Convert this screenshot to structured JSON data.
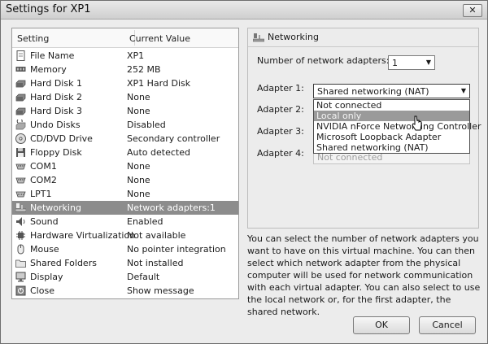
{
  "window": {
    "title": "Settings for XP1",
    "close_glyph": "✕"
  },
  "list": {
    "headers": [
      "Setting",
      "Current Value"
    ],
    "rows": [
      {
        "name": "File Name",
        "value": "XP1",
        "icon": "file-icon"
      },
      {
        "name": "Memory",
        "value": "252 MB",
        "icon": "memory-icon"
      },
      {
        "name": "Hard Disk 1",
        "value": "XP1 Hard Disk",
        "icon": "hard-disk-icon"
      },
      {
        "name": "Hard Disk 2",
        "value": "None",
        "icon": "hard-disk-icon"
      },
      {
        "name": "Hard Disk 3",
        "value": "None",
        "icon": "hard-disk-icon"
      },
      {
        "name": "Undo Disks",
        "value": "Disabled",
        "icon": "undo-disk-icon"
      },
      {
        "name": "CD/DVD Drive",
        "value": "Secondary controller",
        "icon": "cd-dvd-icon"
      },
      {
        "name": "Floppy Disk",
        "value": "Auto detected",
        "icon": "floppy-icon"
      },
      {
        "name": "COM1",
        "value": "None",
        "icon": "com-port-icon"
      },
      {
        "name": "COM2",
        "value": "None",
        "icon": "com-port-icon"
      },
      {
        "name": "LPT1",
        "value": "None",
        "icon": "lpt-port-icon"
      },
      {
        "name": "Networking",
        "value": "Network adapters:1",
        "icon": "network-icon"
      },
      {
        "name": "Sound",
        "value": "Enabled",
        "icon": "sound-icon"
      },
      {
        "name": "Hardware Virtualization",
        "value": "Not available",
        "icon": "chip-icon"
      },
      {
        "name": "Mouse",
        "value": "No pointer integration",
        "icon": "mouse-icon"
      },
      {
        "name": "Shared Folders",
        "value": "Not installed",
        "icon": "folder-icon"
      },
      {
        "name": "Display",
        "value": "Default",
        "icon": "display-icon"
      },
      {
        "name": "Close",
        "value": "Show message",
        "icon": "close-setting-icon"
      }
    ],
    "selected_index": 11
  },
  "networking": {
    "section_title": "Networking",
    "num_adapters_label": "Number of network adapters:",
    "num_adapters_value": "1",
    "adapter1_label": "Adapter 1:",
    "adapter1_value": "Shared networking (NAT)",
    "adapter2_label": "Adapter 2:",
    "adapter3_label": "Adapter 3:",
    "adapter4_label": "Adapter 4:",
    "adapter4_value": "Not connected",
    "dropdown_options": [
      "Not connected",
      "Local only",
      "NVIDIA nForce Networking Controller",
      "Microsoft Loopback Adapter",
      "Shared networking (NAT)"
    ],
    "highlighted_option": 1,
    "description": "You can select the number of network adapters you want to have on this virtual machine. You can then select which network adapter from the physical computer will be used for network communication with each virtual adapter. You can also select to use the local network or, for the first adapter, the shared network."
  },
  "buttons": {
    "ok": "OK",
    "cancel": "Cancel"
  },
  "arrow_glyph": "▼"
}
